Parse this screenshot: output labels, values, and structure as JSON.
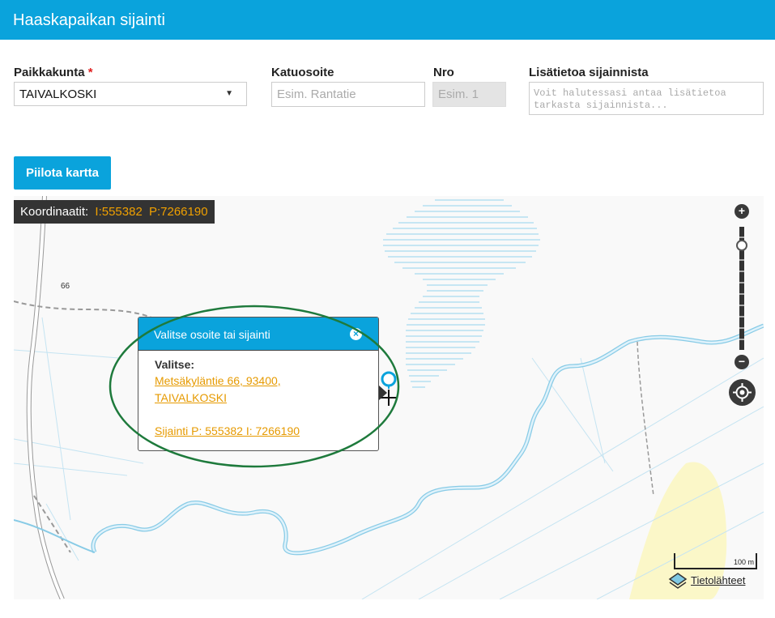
{
  "header": {
    "title": "Haaskapaikan sijainti"
  },
  "form": {
    "municipality": {
      "label": "Paikkakunta",
      "required_mark": "*",
      "value": "TAIVALKOSKI"
    },
    "street": {
      "label": "Katuosoite",
      "placeholder": "Esim. Rantatie"
    },
    "number": {
      "label": "Nro",
      "placeholder": "Esim. 1"
    },
    "extra": {
      "label": "Lisätietoa sijainnista",
      "placeholder": "Voit halutessasi antaa lisätietoa tarkasta sijainnista..."
    }
  },
  "toggle_map_button": "Piilota kartta",
  "map": {
    "coordinates": {
      "label": "Koordinaatit:",
      "i": "I:555382",
      "p": "P:7266190"
    },
    "road_label": "66",
    "zoom_in": "+",
    "zoom_out": "−",
    "scale_label": "100 m",
    "attribution": "Tietolähteet",
    "popup": {
      "title": "Valitse osoite tai sijainti",
      "choose_label": "Valitse:",
      "address_line1": "Metsäkyläntie 66, 93400,",
      "address_line2": "TAIVALKOSKI",
      "location_link": "Sijainti P: 555382 I: 7266190"
    },
    "colors": {
      "water": "#a8dcf0",
      "highlight": "#1e7a3c",
      "accent": "#0aa3dc",
      "link": "#e69a00"
    }
  }
}
